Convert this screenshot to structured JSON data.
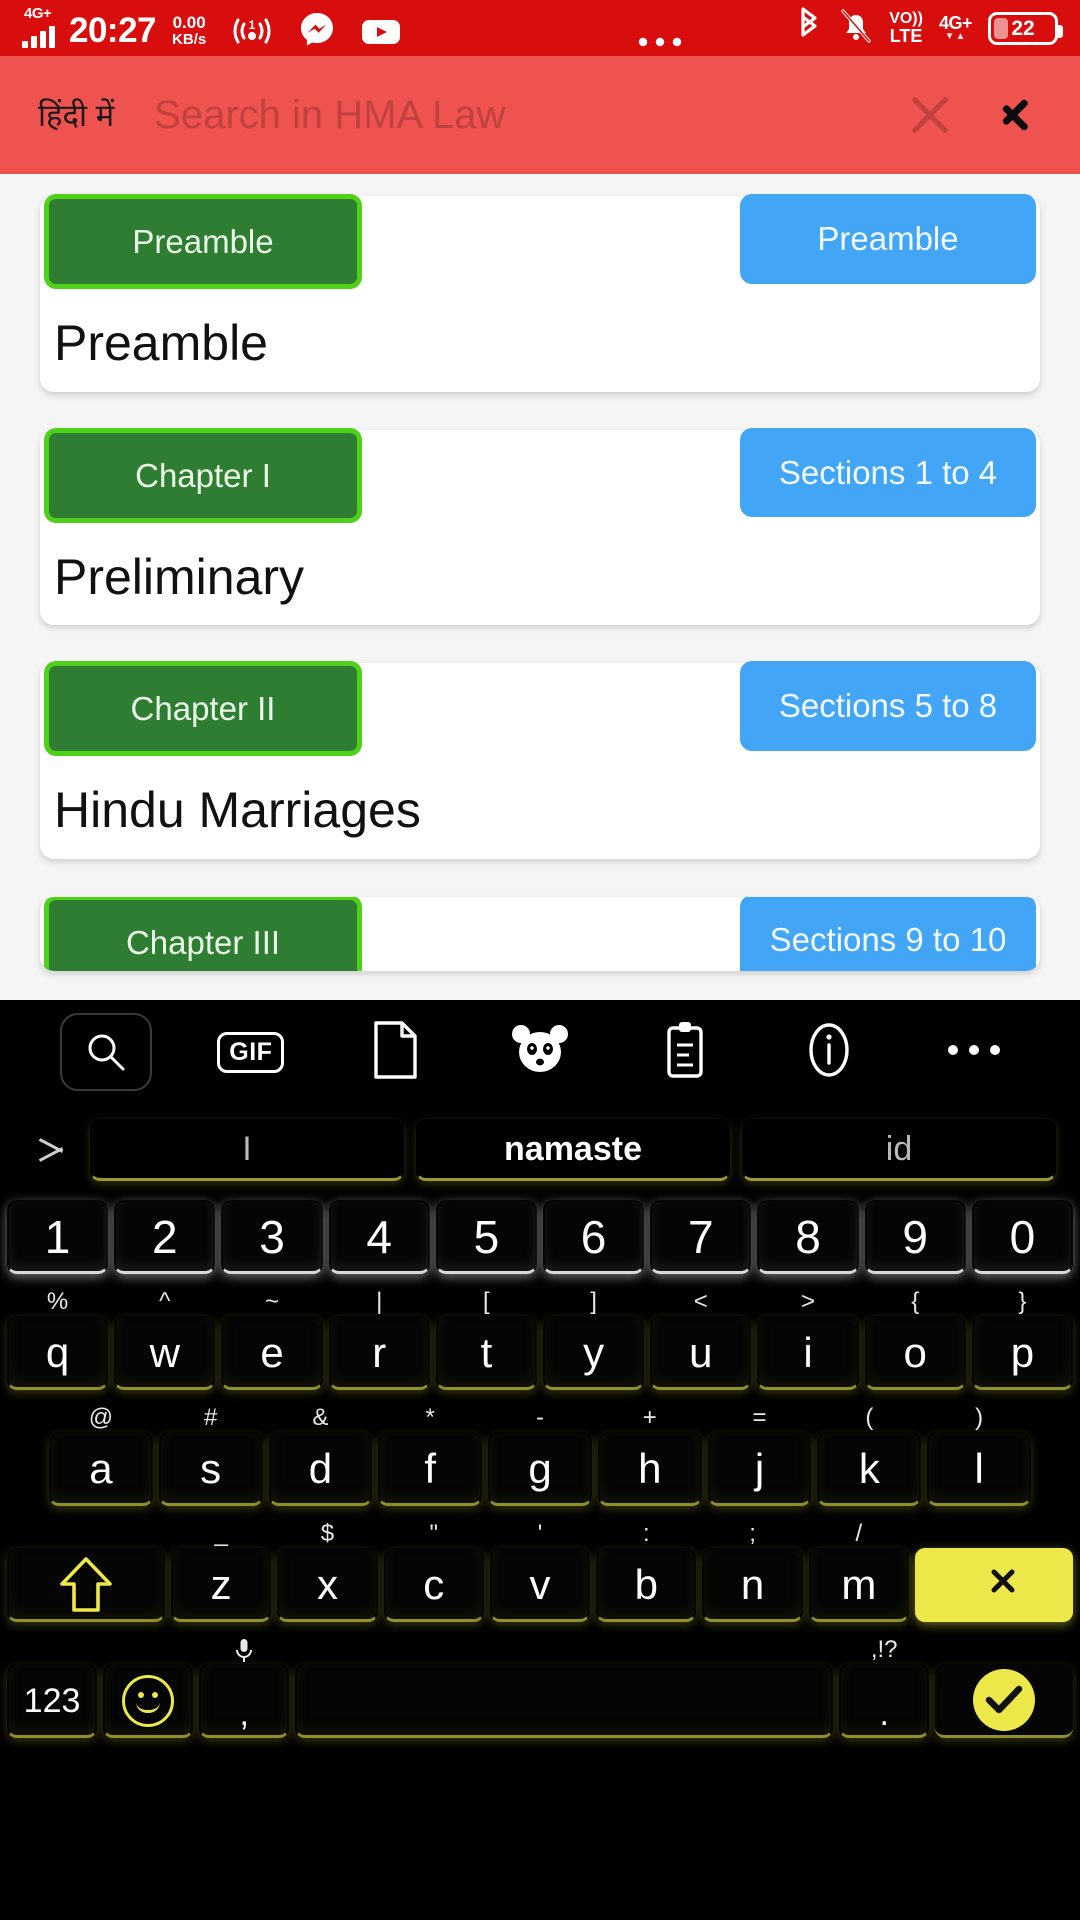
{
  "status_bar": {
    "network_type": "4G+",
    "time": "20:27",
    "net_speed_value": "0.00",
    "net_speed_unit": "KB/s",
    "hotspot_badge": "1",
    "messenger_icon": "messenger-icon",
    "youtube_icon": "youtube-icon",
    "overflow_icon": "more-icon",
    "bluetooth_icon": "bluetooth-icon",
    "mute_icon": "bell-muted-icon",
    "volte_top": "VO))",
    "volte_bottom": "LTE",
    "signal_right": "4G+",
    "signal_arrows": "▼▲",
    "battery_percent": "22",
    "bar_color": "#D80D0D"
  },
  "search": {
    "language_toggle": "हिंदी में",
    "placeholder": "Search in HMA Law",
    "value": "",
    "clear_icon": "close-icon",
    "submit_icon": "chevron-right-icon",
    "bg_color": "#EF5350",
    "text_color": "#C1413E"
  },
  "content": {
    "chip_green_bg": "#2E7D32",
    "chip_green_border": "#4FD019",
    "chip_blue_bg": "#42A5F5",
    "cards": [
      {
        "chapter": "Preamble",
        "sections": "Preamble",
        "title": "Preamble"
      },
      {
        "chapter": "Chapter I",
        "sections": "Sections 1 to 4",
        "title": "Preliminary"
      },
      {
        "chapter": "Chapter II",
        "sections": "Sections 5 to 8",
        "title": "Hindu Marriages"
      },
      {
        "chapter": "Chapter III",
        "sections": "Sections 9 to 10",
        "title": ""
      }
    ]
  },
  "keyboard": {
    "toolbar": [
      {
        "name": "search-icon",
        "label": ""
      },
      {
        "name": "gif-icon",
        "label": "GIF"
      },
      {
        "name": "sticker-icon",
        "label": ""
      },
      {
        "name": "panda-icon",
        "label": ""
      },
      {
        "name": "clipboard-icon",
        "label": ""
      },
      {
        "name": "info-icon",
        "label": ""
      },
      {
        "name": "more-icon",
        "label": "•••"
      }
    ],
    "suggestions": [
      {
        "text": "I",
        "active": false
      },
      {
        "text": "namaste",
        "active": true
      },
      {
        "text": "id",
        "active": false
      }
    ],
    "number_row": [
      "1",
      "2",
      "3",
      "4",
      "5",
      "6",
      "7",
      "8",
      "9",
      "0"
    ],
    "row1": [
      {
        "key": "q",
        "sub": "%"
      },
      {
        "key": "w",
        "sub": "^"
      },
      {
        "key": "e",
        "sub": "~"
      },
      {
        "key": "r",
        "sub": "|"
      },
      {
        "key": "t",
        "sub": "["
      },
      {
        "key": "y",
        "sub": "]"
      },
      {
        "key": "u",
        "sub": "<"
      },
      {
        "key": "i",
        "sub": ">"
      },
      {
        "key": "o",
        "sub": "{"
      },
      {
        "key": "p",
        "sub": "}"
      }
    ],
    "row2": [
      {
        "key": "a",
        "sub": "@"
      },
      {
        "key": "s",
        "sub": "#"
      },
      {
        "key": "d",
        "sub": "&"
      },
      {
        "key": "f",
        "sub": "*"
      },
      {
        "key": "g",
        "sub": "-"
      },
      {
        "key": "h",
        "sub": "+"
      },
      {
        "key": "j",
        "sub": "="
      },
      {
        "key": "k",
        "sub": "("
      },
      {
        "key": "l",
        "sub": ")"
      }
    ],
    "row3": [
      {
        "key": "z",
        "sub": "_"
      },
      {
        "key": "x",
        "sub": "$"
      },
      {
        "key": "c",
        "sub": "\""
      },
      {
        "key": "v",
        "sub": "'"
      },
      {
        "key": "b",
        "sub": ":"
      },
      {
        "key": "n",
        "sub": ";"
      },
      {
        "key": "m",
        "sub": "/"
      }
    ],
    "shift_label": "shift-icon",
    "backspace_label": "backspace-icon",
    "numeric_label": "123",
    "emoji_label": "emoji-icon",
    "comma_key": ",",
    "comma_sub": "mic-icon",
    "space_label": "",
    "period_key": ".",
    "period_sub": ",!?",
    "enter_label": "enter-check-icon",
    "accent_color": "#EDE84A"
  }
}
